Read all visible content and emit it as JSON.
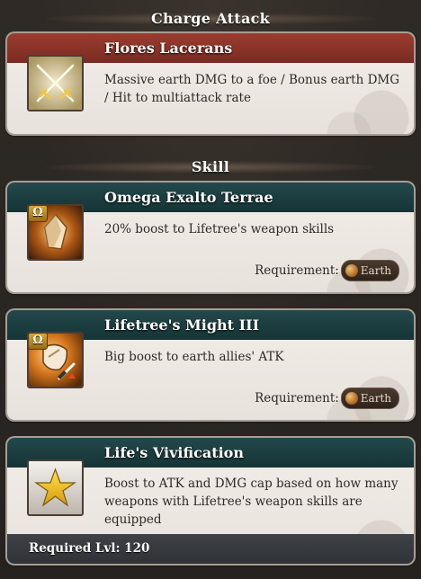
{
  "sections": {
    "charge_attack_header": "Charge Attack",
    "skill_header": "Skill"
  },
  "charge_attack": {
    "name": "Flores Lacerans",
    "description": "Massive earth DMG to a foe / Bonus earth DMG / Hit to multiattack rate",
    "icon": "crossed-swords-icon"
  },
  "skills": [
    {
      "name": "Omega Exalto Terrae",
      "description": "20% boost to Lifetree's weapon skills",
      "icon": "crystal-shard-icon",
      "badge": "Ω",
      "requirement_label": "Requirement:",
      "requirement_element": "Earth"
    },
    {
      "name": "Lifetree's Might III",
      "description": "Big boost to earth allies' ATK",
      "icon": "fist-sword-icon",
      "badge": "Ω",
      "requirement_label": "Requirement:",
      "requirement_element": "Earth"
    },
    {
      "name": "Life's Vivification",
      "description": "Boost to ATK and DMG cap based on how many weapons with Lifetree's weapon skills are equipped",
      "icon": "star-icon",
      "required_level": "Required Lvl: 120"
    }
  ],
  "colors": {
    "charge_header": "#8b3429",
    "skill_header": "#1d3f42",
    "card_bg": "#eee9e4",
    "earth_orb": "#c07a2c"
  }
}
